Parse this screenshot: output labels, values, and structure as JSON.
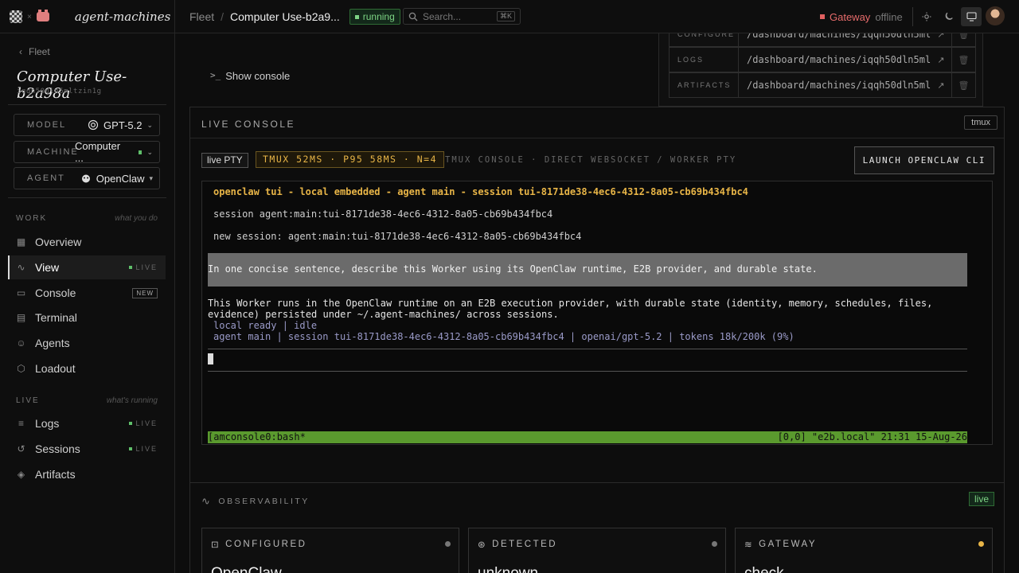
{
  "brand": {
    "name": "agent-machines"
  },
  "header": {
    "breadcrumb_root": "Fleet",
    "breadcrumb_sep": "/",
    "title": "Computer Use-b2a9...",
    "status": "running",
    "search_placeholder": "Search...",
    "search_kbd": "⌘K",
    "gateway_label": "Gateway",
    "gateway_status": "offline"
  },
  "sidebar": {
    "back": "Fleet",
    "machine_name": "Computer Use-b2a98a",
    "machine_id": "iqqh50dln5mltzin1g",
    "model": {
      "label": "MODEL",
      "value": "GPT-5.2"
    },
    "machine": {
      "label": "MACHINE",
      "value": "Computer ..."
    },
    "agent": {
      "label": "AGENT",
      "value": "OpenClaw"
    },
    "work": {
      "title": "WORK",
      "hint": "what you do"
    },
    "work_items": [
      {
        "label": "Overview",
        "icon": "grid-icon"
      },
      {
        "label": "View",
        "icon": "activity-icon",
        "badge": "LIVE"
      },
      {
        "label": "Console",
        "icon": "console-icon",
        "badge": "NEW"
      },
      {
        "label": "Terminal",
        "icon": "terminal-icon"
      },
      {
        "label": "Agents",
        "icon": "bot-icon"
      },
      {
        "label": "Loadout",
        "icon": "package-icon"
      }
    ],
    "live": {
      "title": "LIVE",
      "hint": "what's running"
    },
    "live_items": [
      {
        "label": "Logs",
        "icon": "list-icon",
        "badge": "LIVE"
      },
      {
        "label": "Sessions",
        "icon": "history-icon",
        "badge": "LIVE"
      },
      {
        "label": "Artifacts",
        "icon": "box-icon"
      }
    ]
  },
  "main": {
    "show_console": "Show console",
    "resources": [
      {
        "key": "CONFIGURE",
        "value": "/dashboard/machines/iqqh50dln5mlt..."
      },
      {
        "key": "LOGS",
        "value": "/dashboard/machines/iqqh50dln5mlt..."
      },
      {
        "key": "ARTIFACTS",
        "value": "/dashboard/machines/iqqh50dln5mlt..."
      }
    ],
    "live_console": {
      "title": "LIVE CONSOLE",
      "tmux": "tmux",
      "pty": "live PTY",
      "stats": "TMUX 52MS · P95 58MS · N=4",
      "subtitle": "TMUX CONSOLE · DIRECT WEBSOCKET / WORKER PTY",
      "launch": "LAUNCH OPENCLAW CLI"
    },
    "terminal": {
      "head": "openclaw tui - local embedded - agent main - session tui-8171de38-4ec6-4312-8a05-cb69b434fbc4",
      "line1": "session agent:main:tui-8171de38-4ec6-4312-8a05-cb69b434fbc4",
      "line2": "new session: agent:main:tui-8171de38-4ec6-4312-8a05-cb69b434fbc4",
      "prompt": "In one concise sentence, describe this Worker using its OpenClaw runtime, E2B provider, and durable state.",
      "answer": "This Worker runs in the OpenClaw runtime on an E2B execution provider, with durable state (identity, memory, schedules, files, evidence) persisted under ~/.agent-machines/ across sessions.",
      "state": "local ready | idle",
      "info": "agent main | session tui-8171de38-4ec6-4312-8a05-cb69b434fbc4 | openai/gpt-5.2 | tokens 18k/200k (9%)",
      "status_left": "[amconsole0:bash*",
      "status_right": "[0,0] \"e2b.local\" 21:31 15-Aug-26"
    },
    "observability": {
      "title": "OBSERVABILITY",
      "live": "live",
      "cards": [
        {
          "title": "CONFIGURED",
          "value": "OpenClaw",
          "icon": "bot-icon",
          "dot": "#777777"
        },
        {
          "title": "DETECTED",
          "value": "unknown",
          "icon": "scan-icon",
          "dot": "#777777"
        },
        {
          "title": "GATEWAY",
          "value": "check",
          "icon": "wifi-icon",
          "dot": "#e8b547"
        }
      ]
    }
  },
  "colors": {
    "accent_running": "#7dd484",
    "gateway_offline": "#e66b6b",
    "tmux_status": "#5a9a2e",
    "stats_amber": "#e8b547"
  }
}
